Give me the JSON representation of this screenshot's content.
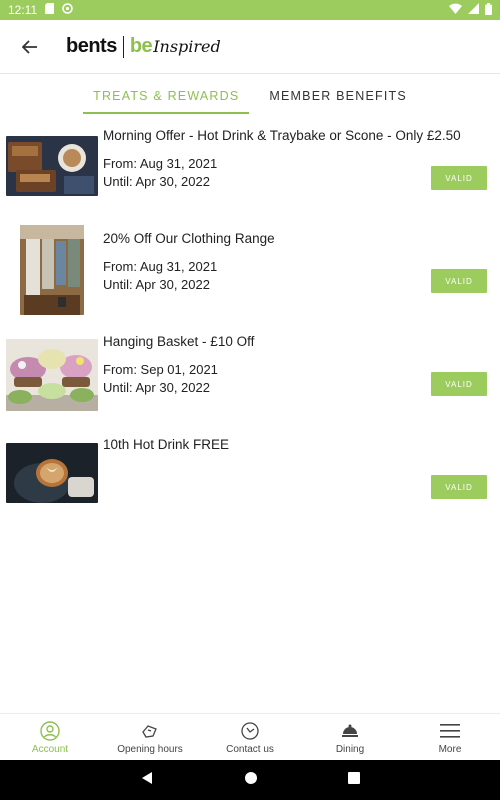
{
  "status": {
    "time": "12:11"
  },
  "header": {
    "logo_left": "bents",
    "logo_right_be": "be",
    "logo_right_inspired": "Inspired"
  },
  "tabs": [
    {
      "label": "TREATS & REWARDS",
      "active": true
    },
    {
      "label": "MEMBER BENEFITS",
      "active": false
    }
  ],
  "offers": [
    {
      "title": "Morning Offer - Hot Drink & Traybake or Scone - Only £2.50",
      "from": "From: Aug 31, 2021",
      "until": "Until: Apr 30, 2022",
      "status": "VALID",
      "image": "cake-and-coffee"
    },
    {
      "title": "20% Off Our Clothing Range",
      "from": "From: Aug 31, 2021",
      "until": "Until: Apr 30, 2022",
      "status": "VALID",
      "image": "clothing-rail"
    },
    {
      "title": "Hanging Basket - £10 Off",
      "from": "From: Sep 01, 2021",
      "until": "Until: Apr 30, 2022",
      "status": "VALID",
      "image": "hanging-baskets"
    },
    {
      "title": "10th Hot Drink FREE",
      "from": "",
      "until": "",
      "status": "VALID",
      "image": "latte-art"
    }
  ],
  "bottom_nav": [
    {
      "label": "Account",
      "icon": "account-icon",
      "active": true
    },
    {
      "label": "Opening hours",
      "icon": "opening-hours-icon",
      "active": false
    },
    {
      "label": "Contact us",
      "icon": "contact-icon",
      "active": false
    },
    {
      "label": "Dining",
      "icon": "dining-icon",
      "active": false
    },
    {
      "label": "More",
      "icon": "menu-icon",
      "active": false
    }
  ],
  "colors": {
    "accent": "#8dc04f",
    "status_bar": "#9ccc5d",
    "valid_button": "#9ccc5d"
  }
}
